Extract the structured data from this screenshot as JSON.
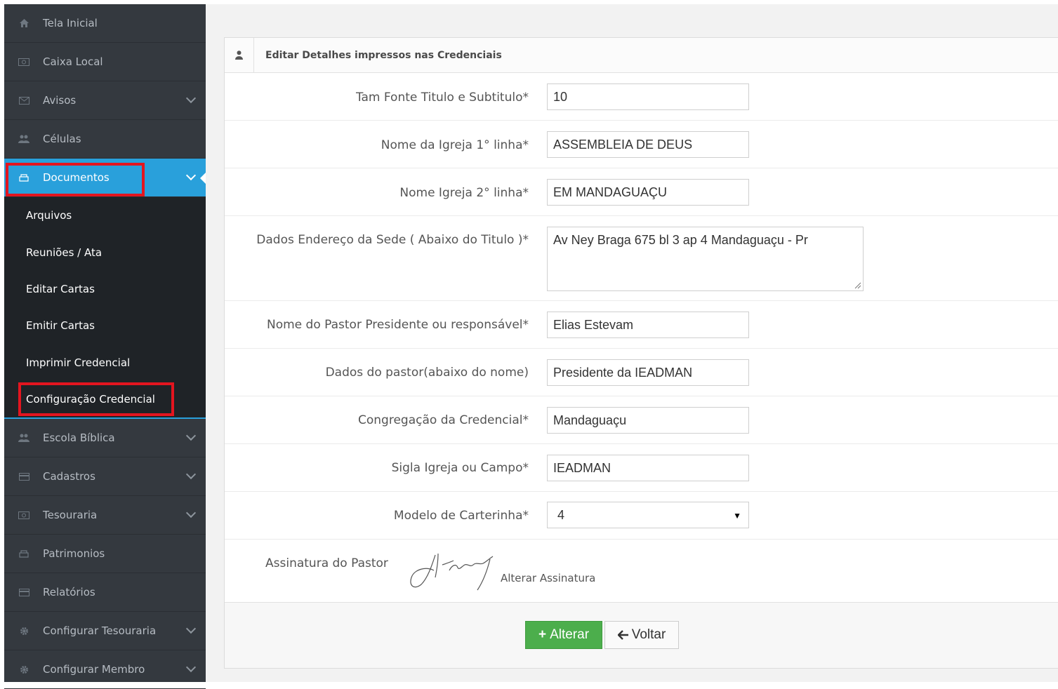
{
  "sidebar": {
    "items": [
      {
        "label": "Tela Inicial",
        "icon": "home-icon"
      },
      {
        "label": "Caixa Local",
        "icon": "money-icon"
      },
      {
        "label": "Avisos",
        "icon": "envelope-icon"
      },
      {
        "label": "Células",
        "icon": "users-icon"
      },
      {
        "label": "Documentos",
        "icon": "folder-icon"
      }
    ],
    "submenu": [
      "Arquivos",
      "Reuniões / Ata",
      "Editar Cartas",
      "Emitir Cartas",
      "Imprimir Credencial",
      "Configuração Credencial"
    ],
    "items_after": [
      {
        "label": "Escola Bíblica",
        "icon": "users-icon"
      },
      {
        "label": "Cadastros",
        "icon": "card-icon"
      },
      {
        "label": "Tesouraria",
        "icon": "money-icon"
      },
      {
        "label": "Patrimonios",
        "icon": "folder-icon"
      },
      {
        "label": "Relatórios",
        "icon": "card-icon"
      },
      {
        "label": "Configurar Tesouraria",
        "icon": "gear-icon"
      },
      {
        "label": "Configurar Membro",
        "icon": "gear-icon"
      }
    ],
    "active_color": "#29a0db",
    "highlight_color": "#e3151f"
  },
  "panel": {
    "title": "Editar Detalhes impressos nas Credenciais",
    "icon": "user-icon"
  },
  "form": {
    "font_size": {
      "label": "Tam Fonte Titulo e Subtitulo*",
      "value": "10"
    },
    "church_line1": {
      "label": "Nome da Igreja 1° linha*",
      "value": "ASSEMBLEIA DE DEUS"
    },
    "church_line2": {
      "label": "Nome Igreja 2° linha*",
      "value": "EM MANDAGUAÇU"
    },
    "address": {
      "label": "Dados Endereço da Sede ( Abaixo do Titulo )*",
      "value": "Av Ney Braga 675 bl 3 ap 4 Mandaguaçu - Pr"
    },
    "pastor_name": {
      "label": "Nome do Pastor Presidente ou responsável*",
      "value": "Elias Estevam"
    },
    "pastor_data": {
      "label": "Dados do pastor(abaixo do nome)",
      "value": "Presidente da IEADMAN"
    },
    "congregation": {
      "label": "Congregação da Credencial*",
      "value": "Mandaguaçu"
    },
    "acronym": {
      "label": "Sigla Igreja ou Campo*",
      "value": "IEADMAN"
    },
    "card_model": {
      "label": "Modelo de Carterinha*",
      "value": "4"
    },
    "signature": {
      "label": "Assinatura do Pastor",
      "link": "Alterar Assinatura"
    }
  },
  "actions": {
    "submit_label": "Alterar",
    "back_label": "Voltar",
    "submit_color": "#4cae4c"
  }
}
